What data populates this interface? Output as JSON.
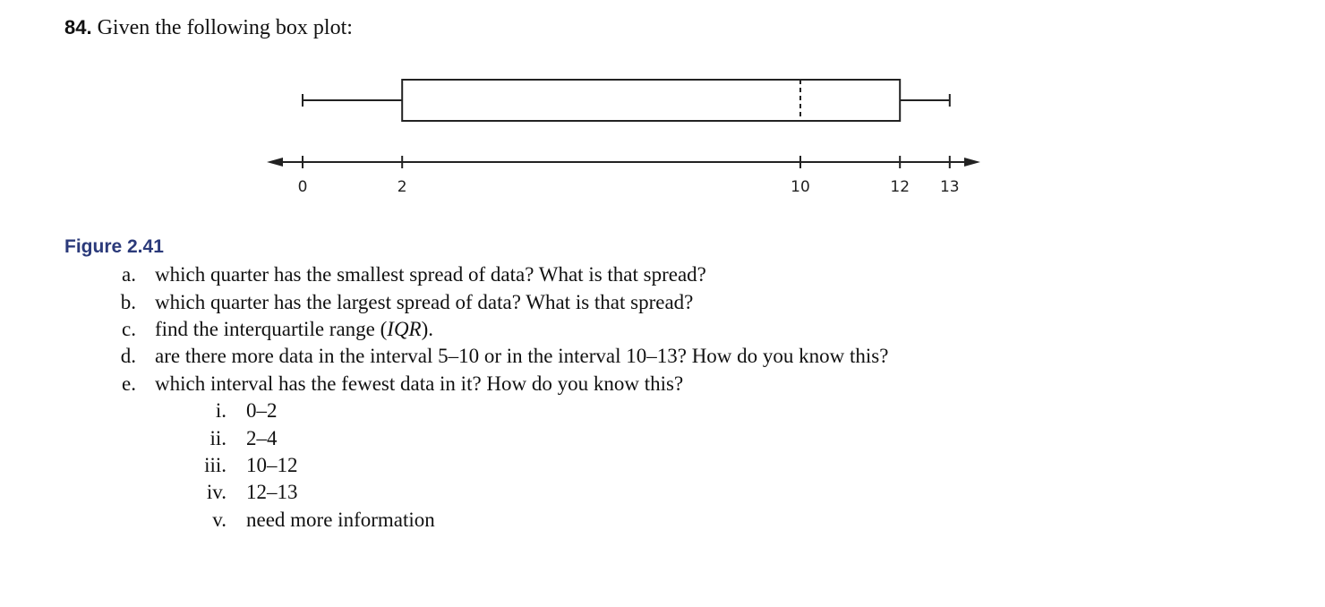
{
  "problem": {
    "number": "84.",
    "prompt": "Given the following box plot:"
  },
  "figure_caption": "Figure 2.41",
  "chart_data": {
    "type": "boxplot",
    "min": 0,
    "q1": 2,
    "median": 10,
    "q3": 12,
    "max": 13,
    "median_style": "dashed",
    "axis": {
      "ticks": [
        0,
        2,
        10,
        12,
        13
      ],
      "tick_labels": [
        "0",
        "2",
        "10",
        "12",
        "13"
      ],
      "arrows": "both"
    }
  },
  "questions": [
    {
      "label": "a.",
      "text": "which quarter has the smallest spread of data? What is that spread?"
    },
    {
      "label": "b.",
      "text": "which quarter has the largest spread of data? What is that spread?"
    },
    {
      "label": "c.",
      "text_before": "find the interquartile range (",
      "italic": "IQR",
      "text_after": ")."
    },
    {
      "label": "d.",
      "text": "are there more data in the interval 5–10 or in the interval 10–13? How do you know this?"
    },
    {
      "label": "e.",
      "text": "which interval has the fewest data in it? How do you know this?"
    }
  ],
  "options": [
    {
      "label": "i.",
      "text": "0–2"
    },
    {
      "label": "ii.",
      "text": "2–4"
    },
    {
      "label": "iii.",
      "text": "10–12"
    },
    {
      "label": "iv.",
      "text": "12–13"
    },
    {
      "label": "v.",
      "text": "need more information"
    }
  ]
}
